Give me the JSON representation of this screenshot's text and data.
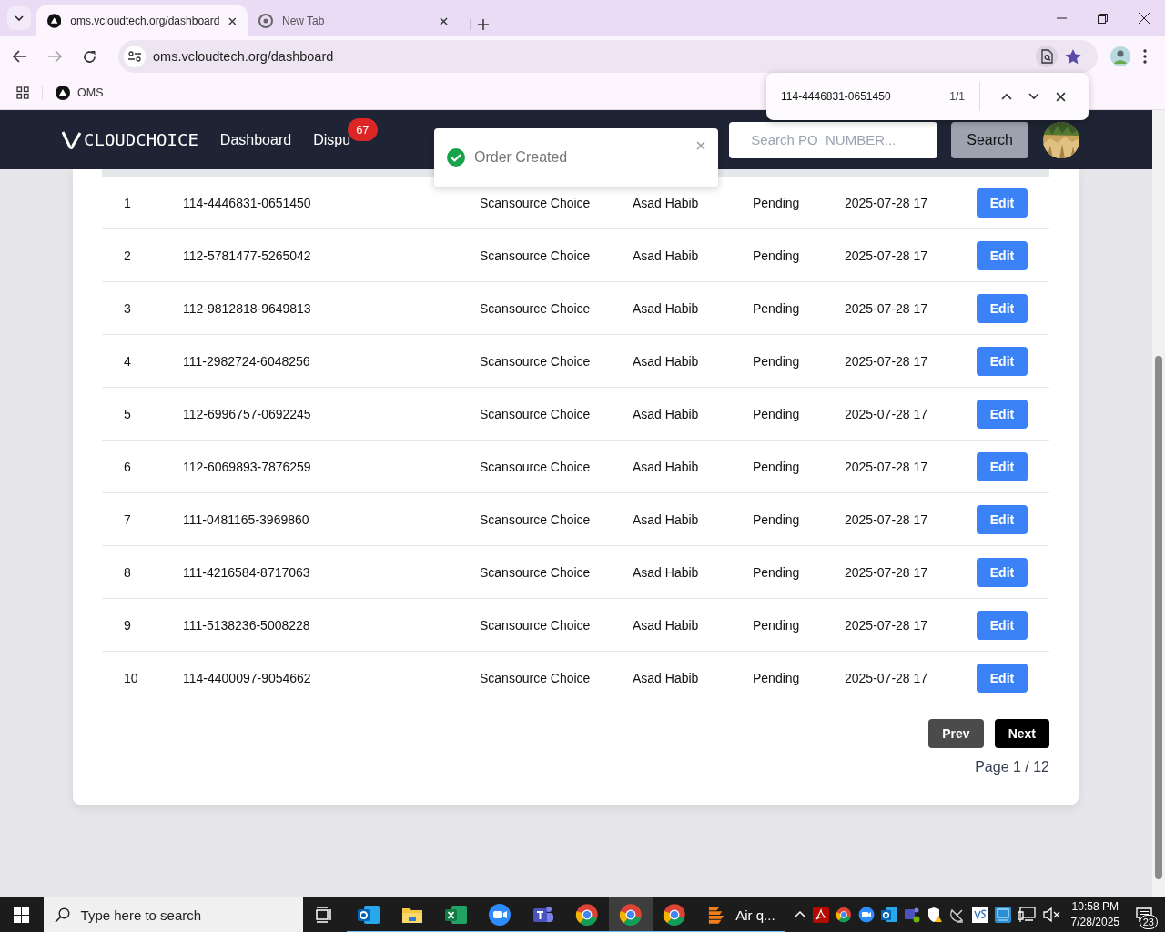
{
  "browser": {
    "tabs": [
      {
        "title": "oms.vcloudtech.org/dashboard",
        "kind": "site",
        "selected": true
      },
      {
        "title": "New Tab",
        "kind": "chrome",
        "selected": false
      }
    ],
    "address": "oms.vcloudtech.org/dashboard",
    "bookmarks": [
      {
        "label": "OMS"
      }
    ],
    "find_bar": {
      "query": "114-4446831-0651450",
      "count": "1/1"
    }
  },
  "app": {
    "logo": "CLOUDCHOICE",
    "nav": [
      {
        "label": "Dashboard"
      },
      {
        "label": "Dispu",
        "badge": "67"
      }
    ],
    "search": {
      "placeholder": "Search PO_NUMBER..."
    },
    "search_button": "Search",
    "toast": {
      "message": "Order Created"
    },
    "rows": [
      {
        "index": "1",
        "po_number": "114-4446831-0651450",
        "vendor": "Scansource Choice",
        "user": "Asad Habib",
        "status": "Pending",
        "date": "2025-07-28 17",
        "action": "Edit"
      },
      {
        "index": "2",
        "po_number": "112-5781477-5265042",
        "vendor": "Scansource Choice",
        "user": "Asad Habib",
        "status": "Pending",
        "date": "2025-07-28 17",
        "action": "Edit"
      },
      {
        "index": "3",
        "po_number": "112-9812818-9649813",
        "vendor": "Scansource Choice",
        "user": "Asad Habib",
        "status": "Pending",
        "date": "2025-07-28 17",
        "action": "Edit"
      },
      {
        "index": "4",
        "po_number": "111-2982724-6048256",
        "vendor": "Scansource Choice",
        "user": "Asad Habib",
        "status": "Pending",
        "date": "2025-07-28 17",
        "action": "Edit"
      },
      {
        "index": "5",
        "po_number": "112-6996757-0692245",
        "vendor": "Scansource Choice",
        "user": "Asad Habib",
        "status": "Pending",
        "date": "2025-07-28 17",
        "action": "Edit"
      },
      {
        "index": "6",
        "po_number": "112-6069893-7876259",
        "vendor": "Scansource Choice",
        "user": "Asad Habib",
        "status": "Pending",
        "date": "2025-07-28 17",
        "action": "Edit"
      },
      {
        "index": "7",
        "po_number": "111-0481165-3969860",
        "vendor": "Scansource Choice",
        "user": "Asad Habib",
        "status": "Pending",
        "date": "2025-07-28 17",
        "action": "Edit"
      },
      {
        "index": "8",
        "po_number": "111-4216584-8717063",
        "vendor": "Scansource Choice",
        "user": "Asad Habib",
        "status": "Pending",
        "date": "2025-07-28 17",
        "action": "Edit"
      },
      {
        "index": "9",
        "po_number": "111-5138236-5008228",
        "vendor": "Scansource Choice",
        "user": "Asad Habib",
        "status": "Pending",
        "date": "2025-07-28 17",
        "action": "Edit"
      },
      {
        "index": "10",
        "po_number": "114-4400097-9054662",
        "vendor": "Scansource Choice",
        "user": "Asad Habib",
        "status": "Pending",
        "date": "2025-07-28 17",
        "action": "Edit"
      }
    ],
    "pagination": {
      "prev": "Prev",
      "next": "Next",
      "page": "Page 1 / 12"
    }
  },
  "taskbar": {
    "search": {
      "placeholder": "Type here to search"
    },
    "apps": [
      {
        "kind": "taskview",
        "running": false,
        "selected": false
      },
      {
        "kind": "outlook",
        "running": true,
        "selected": false
      },
      {
        "kind": "explorer",
        "running": true,
        "selected": false
      },
      {
        "kind": "excel",
        "running": true,
        "selected": false
      },
      {
        "kind": "zoom",
        "running": true,
        "selected": false
      },
      {
        "kind": "teams",
        "running": true,
        "selected": false
      },
      {
        "kind": "chrome",
        "running": true,
        "selected": false
      },
      {
        "kind": "chrome",
        "running": true,
        "selected": true
      },
      {
        "kind": "chrome",
        "running": true,
        "selected": false
      },
      {
        "kind": "air",
        "label": "Air q...",
        "running": true,
        "selected": false
      }
    ],
    "tray": [
      {
        "kind": "chevron"
      },
      {
        "kind": "acrobat"
      },
      {
        "kind": "chrome"
      },
      {
        "kind": "zoom"
      },
      {
        "kind": "outlook"
      },
      {
        "kind": "teams"
      },
      {
        "kind": "shield"
      },
      {
        "kind": "satellite"
      },
      {
        "kind": "vs"
      },
      {
        "kind": "monitor-app"
      },
      {
        "kind": "network"
      },
      {
        "kind": "volume"
      }
    ],
    "time": "10:58 PM",
    "date": "7/28/2025",
    "notifications": "23"
  }
}
